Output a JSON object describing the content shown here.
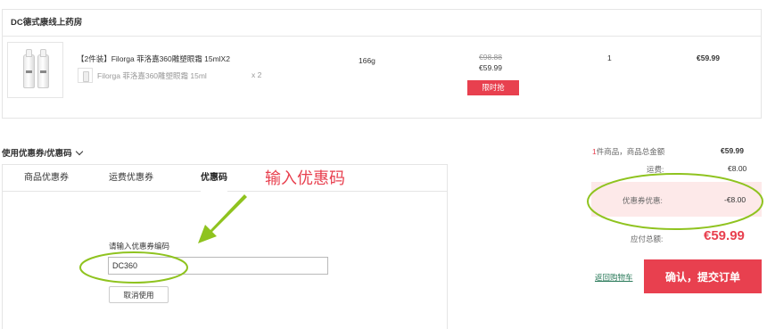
{
  "store": {
    "name": "DC德式康线上药房"
  },
  "product": {
    "name": "【2件装】Filorga 菲洛嘉360雕塑眼霜 15mlX2",
    "sub_name": "Filorga 菲洛嘉360雕塑眼霜 15ml",
    "sub_qty": "x 2",
    "weight": "166g",
    "old_price": "€98.88",
    "price": "€59.99",
    "badge": "限时抢",
    "qty": "1",
    "total": "€59.99"
  },
  "coupon": {
    "title": "使用优惠券/优惠码",
    "tabs": [
      "商品优惠券",
      "运费优惠券",
      "优惠码"
    ],
    "active_tab": "优惠码",
    "annotation": "输入优惠码",
    "input_label": "请输入优惠券编码",
    "input_value": "DC360",
    "cancel_label": "取消使用"
  },
  "summary": {
    "count_num": "1",
    "count_text": "件商品，商品总金额",
    "subtotal": "€59.99",
    "shipping_label": "运费:",
    "shipping": "€8.00",
    "discount_label": "优惠券优惠:",
    "discount": "-€8.00",
    "due_label": "应付总额:",
    "due": "€59.99"
  },
  "actions": {
    "back_label": "返回购物车",
    "submit_label": "确认，提交订单"
  },
  "colors": {
    "accent": "#e8404f",
    "annotation_ring": "#8fc31f",
    "link": "#2a7a5a"
  }
}
